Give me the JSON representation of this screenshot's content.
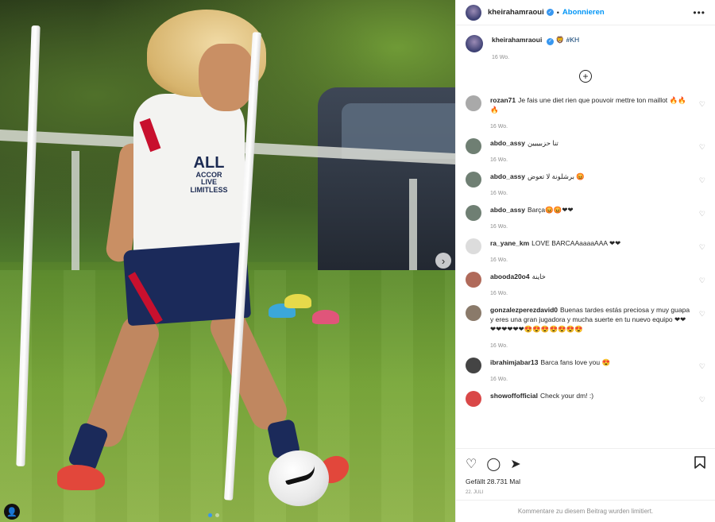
{
  "post": {
    "username": "kheirahamraoui",
    "follow_label": "Abonnieren",
    "dot": "•",
    "more": "•••",
    "caption_emoji": "🦁",
    "caption_text": "#KH",
    "caption_age": "16 Wo.",
    "load_more": "+",
    "likes": "Gefällt 28.731 Mal",
    "date": "22. JULI",
    "comments_limited": "Kommentare zu diesem Beitrag wurden limitiert.",
    "photo_text": {
      "sponsor_brand": "ALL",
      "sponsor_sub": "ACCOR LIVE LIMITLESS"
    }
  },
  "comments": [
    {
      "user": "rozan71",
      "text": "Je fais une diet rien que pouvoir mettre ton maillot 🔥🔥🔥",
      "age": "16 Wo.",
      "avatar_color": "#a9a9a9"
    },
    {
      "user": "abdo_assy",
      "text": "تنا حزبيييين",
      "age": "16 Wo.",
      "avatar_color": "#6f7f73"
    },
    {
      "user": "abdo_assy",
      "text": "برشلونة لا تعوض 😡",
      "age": "16 Wo.",
      "avatar_color": "#6f7f73"
    },
    {
      "user": "abdo_assy",
      "text": "Barça😡😡❤❤",
      "age": "16 Wo.",
      "avatar_color": "#6f7f73"
    },
    {
      "user": "ra_yane_km",
      "text": "LOVE BARCAAaaaaAAA ❤❤",
      "age": "16 Wo.",
      "avatar_color": "#dcdcdc"
    },
    {
      "user": "abooda20o4",
      "text": "خاينة",
      "age": "16 Wo.",
      "avatar_color": "#b06a5a"
    },
    {
      "user": "gonzalezperezdavid0",
      "text": "Buenas tardes estás preciosa y muy guapa y eres una gran jugadora y mucha suerte en tu nuevo equipo ❤❤❤❤❤❤❤❤😍😍😍😍😍😍😍",
      "age": "16 Wo.",
      "avatar_color": "#8a7a6a"
    },
    {
      "user": "ibrahimjabar13",
      "text": "Barca fans love you 😍",
      "age": "16 Wo.",
      "avatar_color": "#444444"
    },
    {
      "user": "showoffofficial",
      "text": "Check your dm! :)",
      "age": "",
      "avatar_color": "#d94848"
    }
  ],
  "icons": {
    "heart": "♡",
    "comment": "◯",
    "share": "➤",
    "bookmark": "🔖",
    "next": "›",
    "user_tag": "👤",
    "verified": "✓"
  }
}
